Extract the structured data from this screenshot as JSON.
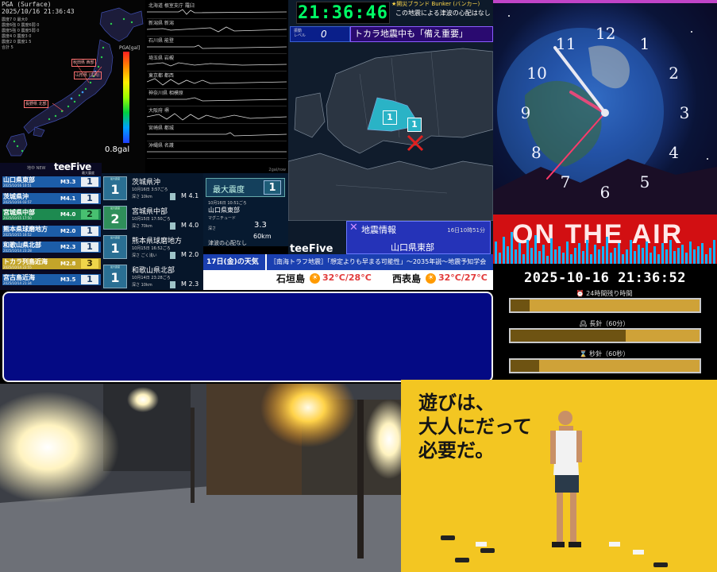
{
  "pga": {
    "title": "PGA (Surface)",
    "datetime": "2025/10/16 21:36:43",
    "stats": [
      "震度7 0 最大0",
      "震度6強 0 震度6弱 0",
      "震度5強 0 震度5弱 0",
      "震度4 0 震度3 0",
      "震度2 0 震度1 5",
      "合計 5"
    ],
    "scale_label": "PGA[gal]",
    "value": "0.8gal",
    "region_tags": [
      "秋田県\n西部",
      "山形県\n(庄内)",
      "長野県\n北部"
    ]
  },
  "waveforms": {
    "stations": [
      "北海道 根室支庁 羅臼",
      "北海道 根室支庁 古小府",
      "新潟県 新潟",
      "石川県 能登",
      "埼玉県 岩槻",
      "東京都 都西",
      "神奈川県 相模原",
      "大阪府 堺",
      "宮崎県 都城",
      "沖縄県 名護"
    ],
    "footer": "2gal/row"
  },
  "eq_list": {
    "logo": "teeFive",
    "subtitle": "地中 NEW",
    "header": "最大震度",
    "items": [
      {
        "place": "山口県東部",
        "time": "2025/10/16 10:51",
        "mag": "M3.3",
        "int": "1",
        "bg": "#1c5da8",
        "badge": "#e9eef2",
        "fg": "#163a6a"
      },
      {
        "place": "茨城県沖",
        "time": "2025/10/16 03:57",
        "mag": "M4.1",
        "int": "1",
        "bg": "#1c5da8",
        "badge": "#e9eef2",
        "fg": "#163a6a"
      },
      {
        "place": "宮城県中部",
        "time": "2025/10/15 17:50",
        "mag": "M4.0",
        "int": "2",
        "bg": "#1d8a50",
        "badge": "#48c070",
        "fg": "#0d3a1a"
      },
      {
        "place": "熊本県球磨地方",
        "time": "2025/10/15 16:52",
        "mag": "M2.0",
        "int": "1",
        "bg": "#1c5da8",
        "badge": "#e9eef2",
        "fg": "#163a6a"
      },
      {
        "place": "和歌山県北部",
        "time": "2025/10/14 23:28",
        "mag": "M2.3",
        "int": "1",
        "bg": "#1c5da8",
        "badge": "#e9eef2",
        "fg": "#163a6a"
      },
      {
        "place": "トカラ列島近海",
        "time": "2025/10/14 22:55",
        "mag": "M2.8",
        "int": "3",
        "bg": "#c3a52a",
        "badge": "#f0d64a",
        "fg": "#3a2c00"
      },
      {
        "place": "宮古島近海",
        "time": "2025/10/14 21:34",
        "mag": "M3.5",
        "int": "1",
        "bg": "#1c5da8",
        "badge": "#e9eef2",
        "fg": "#163a6a"
      }
    ]
  },
  "details": [
    {
      "badge_label": "最大震度",
      "int": "1",
      "place": "茨城県沖",
      "time": "10月16日 3:57ごろ",
      "depth": "深さ 10km",
      "mag": "M 4.1",
      "badge_bg": "#2a6f93"
    },
    {
      "badge_label": "最大震度",
      "int": "2",
      "place": "宮城県中部",
      "time": "10月15日 17:50ごろ",
      "depth": "深さ 70km",
      "mag": "M 4.0",
      "badge_bg": "#2f8f5a"
    },
    {
      "badge_label": "最大震度",
      "int": "1",
      "place": "熊本県球磨地方",
      "time": "10月15日 16:52ごろ",
      "depth": "深さ ごく浅い",
      "mag": "M 2.0",
      "badge_bg": "#2a6f93"
    },
    {
      "badge_label": "最大震度",
      "int": "1",
      "place": "和歌山県北部",
      "time": "10月14日 23:28ごろ",
      "depth": "深さ 10km",
      "mag": "M 2.3",
      "badge_bg": "#2a6f93"
    }
  ],
  "max_card": {
    "label": "最大震度",
    "value": "1",
    "time": "10月16日 10:51ごろ",
    "place": "山口県東部",
    "mag_label": "マグニチュード",
    "mag_value": "3.3",
    "depth_label": "深さ",
    "depth_value": "60km",
    "tsunami": "津波の心配なし"
  },
  "region_map": {
    "clock": "21:36:46",
    "notice_top": "★開災ブランド Bunker (バンカー)",
    "notice_sub": "この地震による津波の心配はなし",
    "level_label": "振動\nレベル",
    "level_value": "0",
    "banner": "トカラ地震中も「備え重要」",
    "logo": "teeFive",
    "info_title": "地震情報",
    "info_time": "16日10時51分",
    "info_region": "山口県東部",
    "marker_int_1": "1",
    "marker_int_2": "1"
  },
  "ticker": {
    "weather_label": "17日(金)の天気",
    "headline": "［南海トラフ地震］「想定よりも早まる可能性」～2035年説～地震予知学会"
  },
  "weather": {
    "city1": "石垣島",
    "temp1": "32°C/28°C",
    "city2": "西表島",
    "temp2": "32°C/27°C",
    "icon": "sun-cloud-icon"
  },
  "analog_clock": {
    "numbers": [
      "12",
      "1",
      "2",
      "3",
      "4",
      "5",
      "6",
      "7",
      "8",
      "9",
      "10",
      "11"
    ]
  },
  "onair": {
    "text": "ON THE AIR"
  },
  "timers": {
    "datetime": "2025-10-16 21:36:52",
    "items": [
      {
        "label": "⏰ 24時間残り時間",
        "progress": 0.1
      },
      {
        "label": "🕰 長針（60分）",
        "progress": 0.61
      },
      {
        "label": "⌛ 秒針（60秒）",
        "progress": 0.15
      }
    ]
  },
  "ad": {
    "lines": [
      "遊びは、",
      "大人にだって",
      "必要だ。"
    ]
  }
}
